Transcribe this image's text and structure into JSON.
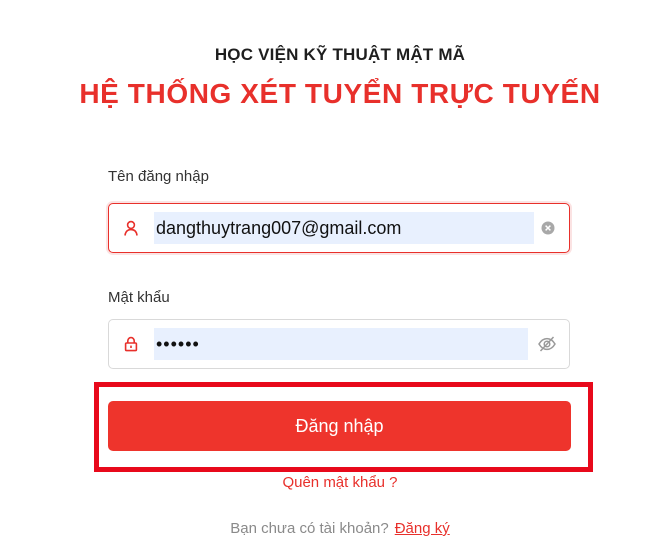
{
  "header": {
    "school_name": "HỌC VIỆN KỸ THUẬT MẬT MÃ",
    "system_title": "HỆ THỐNG XÉT TUYỂN TRỰC TUYẾN"
  },
  "form": {
    "username": {
      "label": "Tên đăng nhập",
      "value": "dangthuytrang007@gmail.com",
      "icon": "user-icon",
      "trailing_icon": "clear-icon"
    },
    "password": {
      "label": "Mật khẩu",
      "value": "••••••",
      "icon": "lock-icon",
      "trailing_icon": "eye-slash-icon"
    },
    "submit_label": "Đăng nhập",
    "forgot_label": "Quên mật khẩu ?"
  },
  "footer": {
    "no_account_text": "Bạn chưa có tài khoản?",
    "register_label": "Đăng ký"
  },
  "colors": {
    "brand_red": "#e8302b",
    "button_red": "#ee342c",
    "highlight_red": "#e8091b",
    "autofill_blue": "#e8f0fe"
  }
}
